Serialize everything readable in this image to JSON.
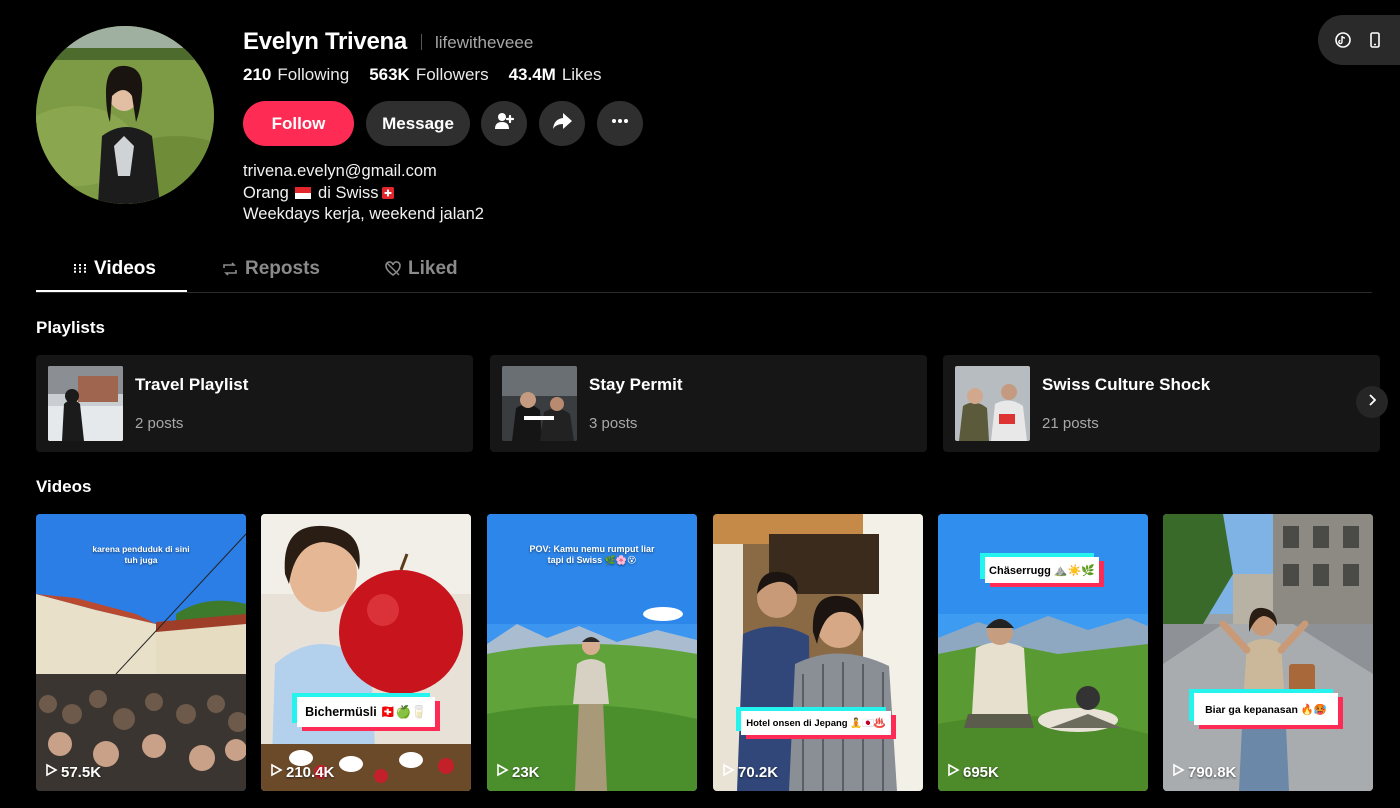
{
  "profile": {
    "display_name": "Evelyn Trivena",
    "username": "lifewitheveee",
    "stats": [
      {
        "value": "210",
        "label": "Following"
      },
      {
        "value": "563K",
        "label": "Followers"
      },
      {
        "value": "43.4M",
        "label": "Likes"
      }
    ],
    "bio": {
      "line1": "trivena.evelyn@gmail.com",
      "line2_a": "Orang",
      "line2_b": "di Swiss",
      "line3": "Weekdays kerja, weekend jalan2"
    }
  },
  "actions": {
    "follow_label": "Follow",
    "message_label": "Message",
    "add_friend_icon": "add-user-icon",
    "share_icon": "share-icon",
    "more_icon": "more-icon"
  },
  "tabs": [
    {
      "label": "Videos",
      "icon": "grid-icon",
      "active": true
    },
    {
      "label": "Reposts",
      "icon": "repost-icon",
      "active": false
    },
    {
      "label": "Liked",
      "icon": "heart-icon",
      "active": false
    }
  ],
  "playlists_section": {
    "title": "Playlists",
    "items": [
      {
        "title": "Travel Playlist",
        "count": "2 posts"
      },
      {
        "title": "Stay Permit",
        "count": "3 posts"
      },
      {
        "title": "Swiss Culture Shock",
        "count": "21 posts"
      }
    ]
  },
  "videos_section": {
    "title": "Videos",
    "items": [
      {
        "views": "57.5K",
        "caption": "karena penduduk di sini tuh juga",
        "sticker": ""
      },
      {
        "views": "210.4K",
        "caption": "",
        "sticker": "Bichermüsli 🇨🇭🍏🥛"
      },
      {
        "views": "23K",
        "caption": "POV: Kamu nemu rumput liar tapi di Swiss 🌿🌸😵",
        "sticker": ""
      },
      {
        "views": "70.2K",
        "caption": "",
        "sticker": "Hotel onsen di Jepang 🧘🇯🇵♨️"
      },
      {
        "views": "695K",
        "caption": "",
        "sticker": "Chäserrugg ⛰️☀️🌿"
      },
      {
        "views": "790.8K",
        "caption": "",
        "sticker": "Biar ga kepanasan 🔥🥵"
      }
    ]
  },
  "colors": {
    "accent": "#fe2c55",
    "sticker_cyan": "#25f4ee",
    "background": "#000000"
  }
}
